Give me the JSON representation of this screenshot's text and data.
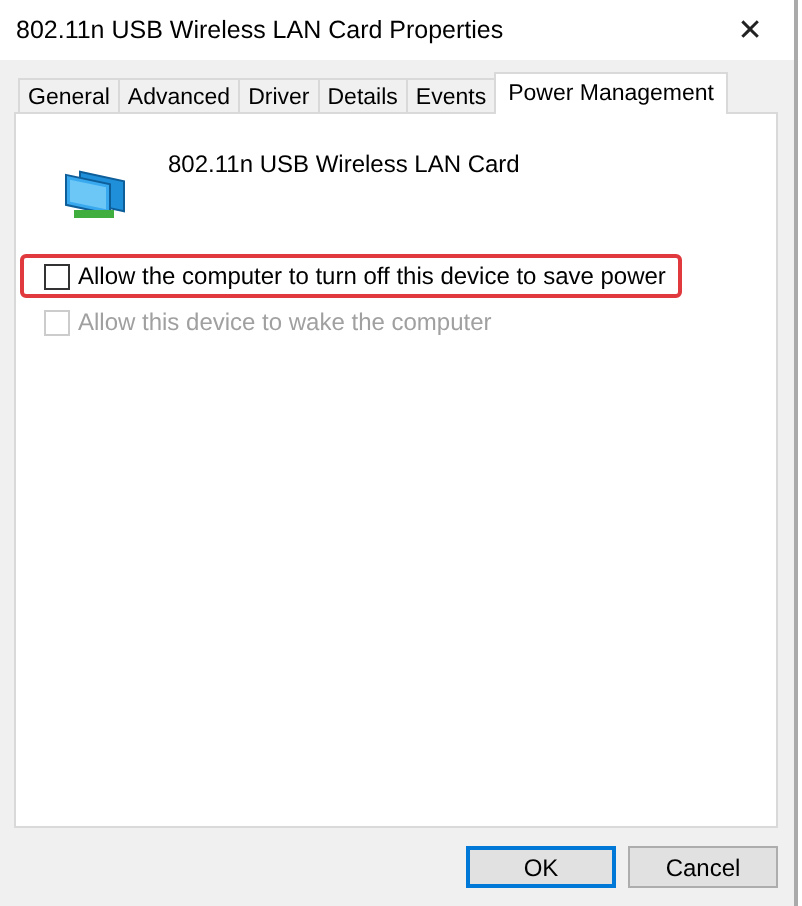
{
  "window": {
    "title": "802.11n USB Wireless LAN Card Properties",
    "close": "✕"
  },
  "tabs": [
    {
      "label": "General",
      "selected": false
    },
    {
      "label": "Advanced",
      "selected": false
    },
    {
      "label": "Driver",
      "selected": false
    },
    {
      "label": "Details",
      "selected": false
    },
    {
      "label": "Events",
      "selected": false
    },
    {
      "label": "Power Management",
      "selected": true
    }
  ],
  "device": {
    "name": "802.11n USB Wireless LAN Card"
  },
  "options": [
    {
      "label": "Allow the computer to turn off this device to save power",
      "checked": false,
      "disabled": false,
      "highlighted": true
    },
    {
      "label": "Allow this device to wake the computer",
      "checked": false,
      "disabled": true,
      "highlighted": false
    }
  ],
  "buttons": [
    {
      "label": "OK",
      "default": true
    },
    {
      "label": "Cancel",
      "default": false
    }
  ]
}
